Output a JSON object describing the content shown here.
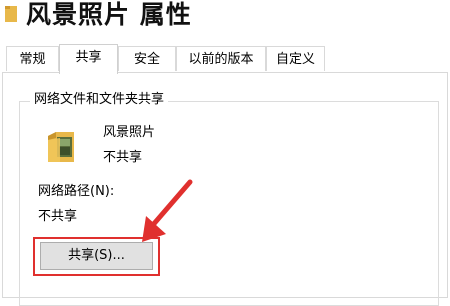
{
  "window": {
    "title": "风景照片 属性",
    "title_icon": "folder-icon"
  },
  "tabs": [
    {
      "label": "常规",
      "active": false
    },
    {
      "label": "共享",
      "active": true
    },
    {
      "label": "安全",
      "active": false
    },
    {
      "label": "以前的版本",
      "active": false
    },
    {
      "label": "自定义",
      "active": false
    }
  ],
  "share_panel": {
    "group_title": "网络文件和文件夹共享",
    "folder_icon": "photo-folder-icon",
    "folder_name": "风景照片",
    "folder_status": "不共享",
    "network_path_label": "网络路径(N):",
    "network_path_value": "不共享",
    "share_button_label": "共享(S)..."
  },
  "colors": {
    "annotation_red": "#e0302e",
    "folder_yellow": "#e8b84a"
  }
}
